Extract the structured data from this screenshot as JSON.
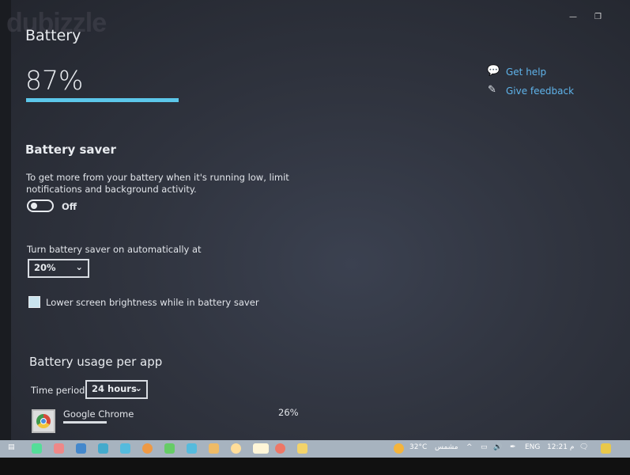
{
  "watermark": "dubizzle",
  "page": {
    "title": "Battery",
    "percent": "87%",
    "charge_fraction": 0.87
  },
  "help": {
    "get_help": "Get help",
    "give_feedback": "Give feedback"
  },
  "saver": {
    "heading": "Battery saver",
    "description_line1": "To get more from your battery when it's running low, limit",
    "description_line2": "notifications and background activity.",
    "toggle_state": "Off",
    "auto_label": "Turn battery saver on automatically at",
    "auto_value": "20%",
    "brightness_label": "Lower screen brightness while in battery saver",
    "brightness_checked": false
  },
  "usage": {
    "heading": "Battery usage per app",
    "period_label": "Time period:",
    "period_value": "24 hours",
    "apps": [
      {
        "name": "Google Chrome",
        "percent": "26%"
      }
    ]
  },
  "taskbar": {
    "weather": "32°C",
    "weather_desc": "مشمس",
    "language": "ENG",
    "time": "12:21 م"
  },
  "colors": {
    "accent": "#5cc7ea",
    "link": "#5fb3ea"
  }
}
